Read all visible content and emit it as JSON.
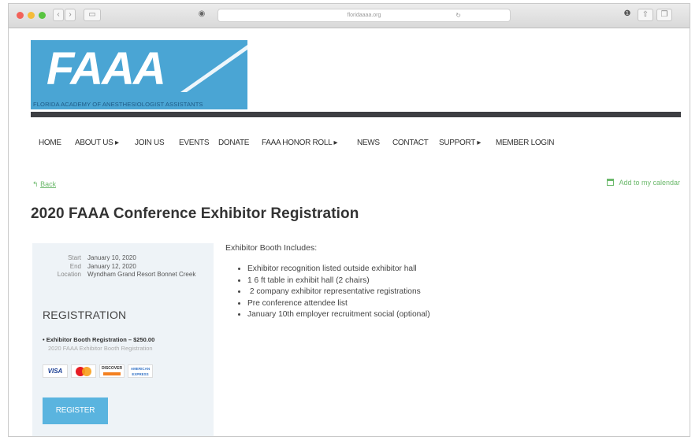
{
  "browser": {
    "url": "floridaaaa.org",
    "reload_glyph": "↻",
    "back_glyph": "‹",
    "forward_glyph": "›",
    "sidebar_glyph": "▭",
    "privacy_glyph": "◉",
    "share_glyph": "⇧",
    "tabs_glyph": "❐",
    "info_glyph": "❶"
  },
  "logo": {
    "text": "FAAA",
    "tagline": "FLORIDA ACADEMY OF ANESTHESIOLOGIST ASSISTANTS",
    "bg_color": "#4aa5d4"
  },
  "nav": {
    "items": [
      {
        "label": "HOME"
      },
      {
        "label": "ABOUT US ▸"
      },
      {
        "label": "JOIN US"
      },
      {
        "label": "EVENTS"
      },
      {
        "label": "DONATE"
      },
      {
        "label": "FAAA HONOR ROLL ▸"
      },
      {
        "label": "NEWS"
      },
      {
        "label": "CONTACT"
      },
      {
        "label": "SUPPORT ▸"
      },
      {
        "label": "MEMBER LOGIN"
      }
    ]
  },
  "links": {
    "back": "Back",
    "back_icon": "↰",
    "calendar": "Add to my calendar"
  },
  "event": {
    "title": "2020 FAAA Conference Exhibitor Registration",
    "start_label": "Start",
    "start": "January 10, 2020",
    "end_label": "End",
    "end": "January 12, 2020",
    "location_label": "Location",
    "location": "Wyndham Grand Resort Bonnet Creek"
  },
  "registration": {
    "heading": "REGISTRATION",
    "item": "• Exhibitor Booth Registration – $250.00",
    "item_desc": "2020 FAAA Exhibitor Booth Registration",
    "cards": {
      "visa": "VISA",
      "discover": "DISCOVER",
      "amex": "AMERICAN EXPRESS"
    },
    "button": "REGISTER",
    "button_color": "#5ab4df"
  },
  "content": {
    "intro": "Exhibitor Booth Includes:",
    "bullets": [
      "Exhibitor recognition listed outside exhibitor hall",
      "1 6 ft table in exhibit hall (2 chairs)",
      " 2 company exhibitor representative registrations",
      "Pre conference attendee list",
      "January 10th employer recruitment social (optional)"
    ]
  },
  "colors": {
    "link_green": "#6cb96c",
    "rule": "#3d3e42",
    "sidebar_bg": "#eef3f7"
  }
}
